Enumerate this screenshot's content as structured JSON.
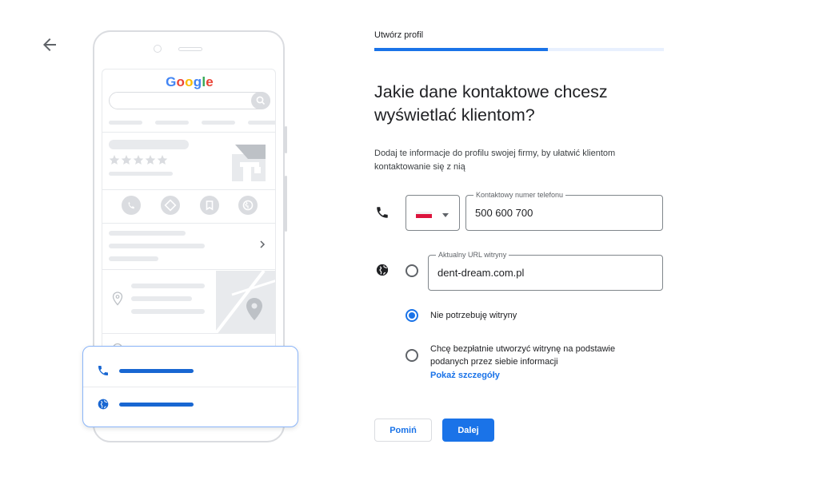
{
  "nav": {
    "back_icon": "arrow-back-icon"
  },
  "illustration": {
    "google_logo": {
      "letters": [
        "G",
        "o",
        "o",
        "g",
        "l",
        "e"
      ],
      "colors": [
        "#4285f4",
        "#ea4335",
        "#fbbc05",
        "#4285f4",
        "#34a853",
        "#ea4335"
      ]
    },
    "action_icons": [
      "phone-icon",
      "directions-icon",
      "bookmark-icon",
      "globe-icon"
    ],
    "card_icons": [
      "phone-icon",
      "globe-icon"
    ]
  },
  "step": {
    "label": "Utwórz profil",
    "progress": 0.6
  },
  "title": "Jakie dane kontaktowe chcesz wyświetlać klientom?",
  "description": "Dodaj te informacje do profilu swojej firmy, by ułatwić klientom kontaktowanie się z nią",
  "phone": {
    "icon": "phone-icon",
    "country_flag": "PL",
    "label": "Kontaktowy numer telefonu",
    "value": "500 600 700"
  },
  "website": {
    "icon": "globe-icon",
    "label": "Aktualny URL witryny",
    "value": "dent-dream.com.pl",
    "option_no_site": "Nie potrzebuję witryny",
    "option_create_site": "Chcę bezpłatnie utworzyć witrynę na podstawie podanych przez siebie informacji",
    "show_details": "Pokaż szczegóły",
    "selected": "no_site"
  },
  "buttons": {
    "skip": "Pomiń",
    "next": "Dalej"
  },
  "colors": {
    "accent": "#1a73e8",
    "card_line": "#1967d2"
  }
}
